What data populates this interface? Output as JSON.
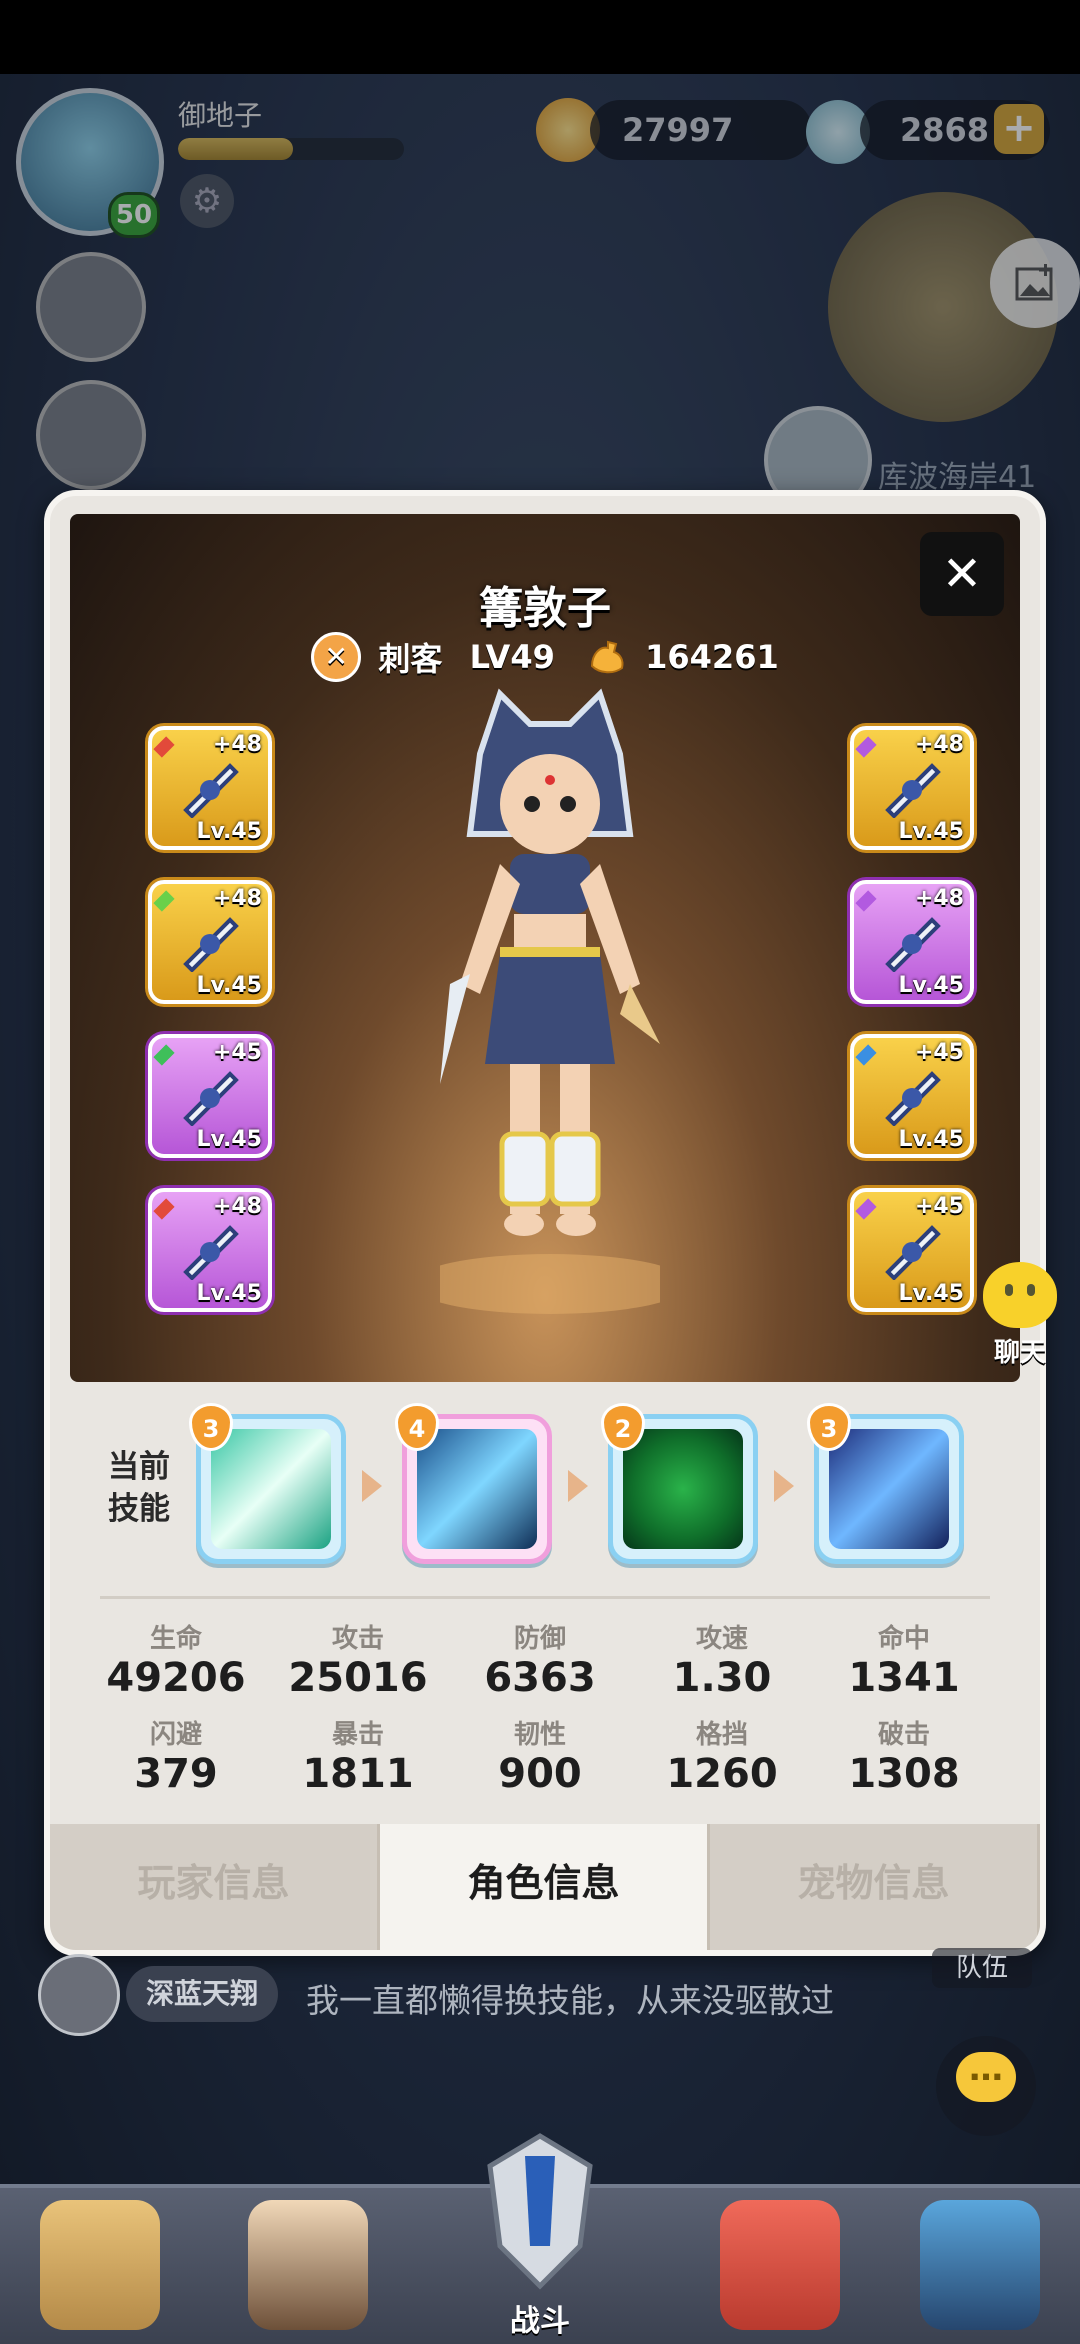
{
  "player": {
    "name": "御地子",
    "level": "50",
    "xp_fraction": 0.51
  },
  "currency": {
    "gold": "27997",
    "shells": "2868",
    "add_label": "+"
  },
  "map": {
    "location": "库波海岸41"
  },
  "hero": {
    "name": "篝敦子",
    "class": "刺客",
    "level": "LV49",
    "power": "164261",
    "close_label": "✕"
  },
  "equipment": {
    "left": [
      {
        "plus": "+48",
        "level": "Lv.45",
        "rarity": "gold",
        "gem_color": "#e24a3a",
        "icon": "lance-icon"
      },
      {
        "plus": "+48",
        "level": "Lv.45",
        "rarity": "gold",
        "gem_color": "#69d04a",
        "icon": "wolf-helmet-icon"
      },
      {
        "plus": "+45",
        "level": "Lv.45",
        "rarity": "purple",
        "gem_color": "#3fbf5a",
        "icon": "claw-glove-icon"
      },
      {
        "plus": "+48",
        "level": "Lv.45",
        "rarity": "purple",
        "gem_color": "#e24a3a",
        "icon": "ring-icon"
      }
    ],
    "right": [
      {
        "plus": "+48",
        "level": "Lv.45",
        "rarity": "gold",
        "gem_color": "#b25ae0",
        "icon": "dagger-icon"
      },
      {
        "plus": "+48",
        "level": "Lv.45",
        "rarity": "purple",
        "gem_color": "#b25ae0",
        "icon": "hood-armor-icon"
      },
      {
        "plus": "+45",
        "level": "Lv.45",
        "rarity": "gold",
        "gem_color": "#3a8fe2",
        "icon": "leg-armor-icon"
      },
      {
        "plus": "+45",
        "level": "Lv.45",
        "rarity": "gold",
        "gem_color": "#b25ae0",
        "icon": "necklace-icon"
      }
    ]
  },
  "skills": {
    "label": "当前\n技能",
    "label_line1": "当前",
    "label_line2": "技能",
    "items": [
      {
        "level": "3",
        "icon": "slash-burst-icon",
        "frame": "blue"
      },
      {
        "level": "4",
        "icon": "kunai-icon",
        "frame": "pink"
      },
      {
        "level": "2",
        "icon": "leaf-spirit-icon",
        "frame": "blue"
      },
      {
        "level": "3",
        "icon": "lightning-blade-icon",
        "frame": "blue"
      }
    ]
  },
  "stats": [
    {
      "label": "生命",
      "value": "49206"
    },
    {
      "label": "攻击",
      "value": "25016"
    },
    {
      "label": "防御",
      "value": "6363"
    },
    {
      "label": "攻速",
      "value": "1.30"
    },
    {
      "label": "命中",
      "value": "1341"
    },
    {
      "label": "闪避",
      "value": "379"
    },
    {
      "label": "暴击",
      "value": "1811"
    },
    {
      "label": "韧性",
      "value": "900"
    },
    {
      "label": "格挡",
      "value": "1260"
    },
    {
      "label": "破击",
      "value": "1308"
    }
  ],
  "tabs": [
    {
      "label": "玩家信息",
      "active": false
    },
    {
      "label": "角色信息",
      "active": true
    },
    {
      "label": "宠物信息",
      "active": false
    }
  ],
  "chat": {
    "user": "深蓝天翔",
    "message": "我一直都懒得换技能，从来没驱散过",
    "float_label": "聊天",
    "team_label": "队伍"
  },
  "bottom_nav": {
    "battle_label": "战斗"
  },
  "colors": {
    "card_bg": "#e9e6e1",
    "gold_frame": "#f9d14a",
    "purple_frame": "#c76fe6",
    "skill_blue": "#8ad0f2",
    "skill_pink": "#f09fdc",
    "badge_orange": "#f39c2e"
  }
}
